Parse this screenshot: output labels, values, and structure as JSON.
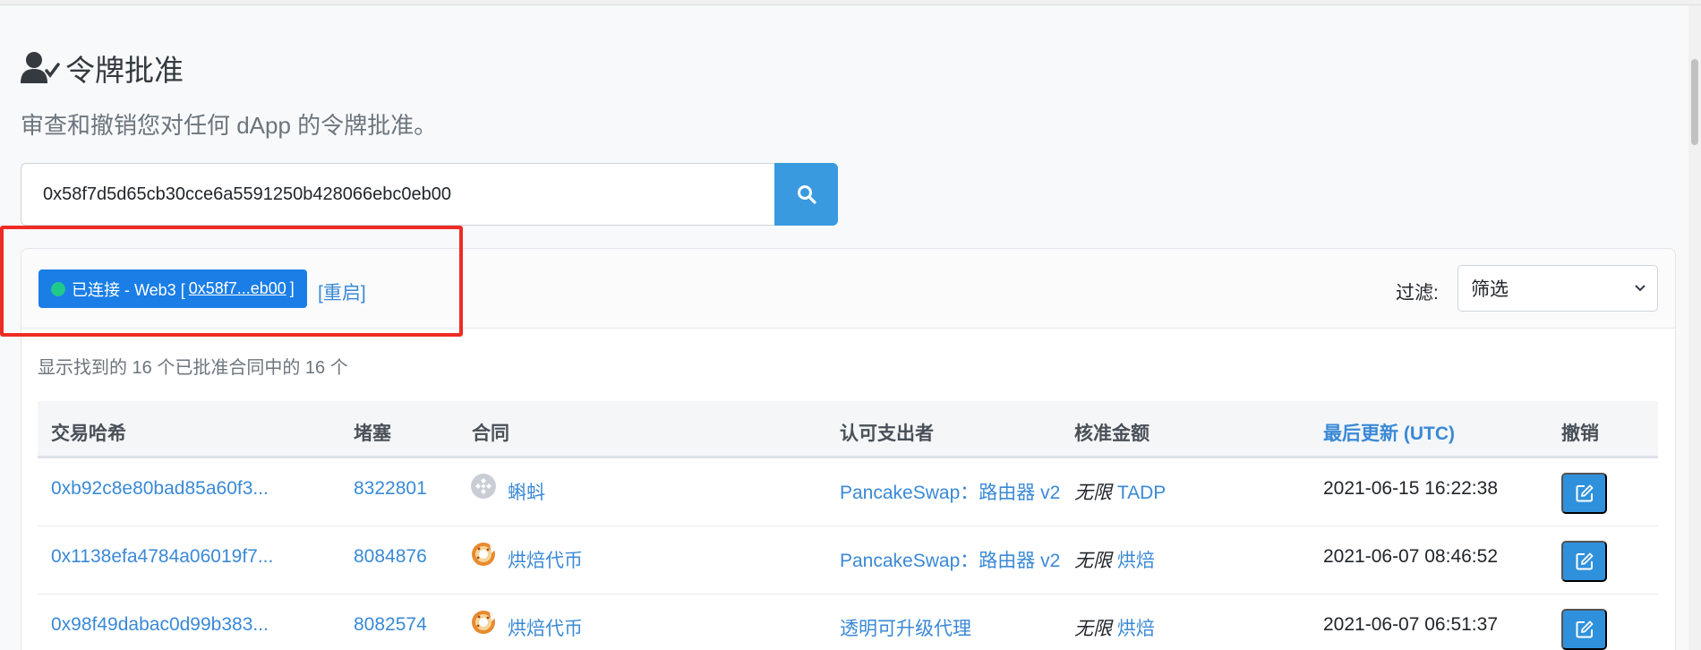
{
  "header": {
    "title": "令牌批准",
    "subtitle": "审查和撤销您对任何 dApp 的令牌批准。"
  },
  "search": {
    "value": "0x58f7d5d65cb30cce6a5591250b428066ebc0eb00"
  },
  "connection": {
    "prefix": "已连接 - Web3 [",
    "address": "0x58f7...eb00",
    "suffix": "]",
    "restart": "[重启]"
  },
  "filter": {
    "label": "过滤:",
    "selected": "筛选"
  },
  "count_text": "显示找到的 16 个已批准合同中的 16 个",
  "table": {
    "columns": {
      "hash": "交易哈希",
      "block": "堵塞",
      "contract": "合同",
      "spender": "认可支出者",
      "amount": "核准金额",
      "updated": "最后更新 (UTC)",
      "revoke": "撤销"
    },
    "rows": [
      {
        "hash": "0xb92c8e80bad85a60f3...",
        "block": "8322801",
        "contract_icon": "gray-bnb-token-icon",
        "contract": "蝌蚪",
        "spender": "PancakeSwap：路由器 v2",
        "amount_prefix": "无限",
        "amount_token": "TADP",
        "updated": "2021-06-15 16:22:38"
      },
      {
        "hash": "0x1138efa4784a06019f7...",
        "block": "8084876",
        "contract_icon": "bake-token-icon",
        "contract": "烘焙代币",
        "spender": "PancakeSwap：路由器 v2",
        "amount_prefix": "无限",
        "amount_token": "烘焙",
        "updated": "2021-06-07 08:46:52"
      },
      {
        "hash": "0x98f49dabac0d99b383...",
        "block": "8082574",
        "contract_icon": "bake-token-icon",
        "contract": "烘焙代币",
        "spender": "透明可升级代理",
        "amount_prefix": "无限",
        "amount_token": "烘焙",
        "updated": "2021-06-07 06:51:37"
      }
    ]
  },
  "colors": {
    "accent": "#3a9ae0",
    "badge": "#1a7ee6",
    "status_dot": "#1fc98a",
    "highlight_box": "#ee2b24"
  }
}
